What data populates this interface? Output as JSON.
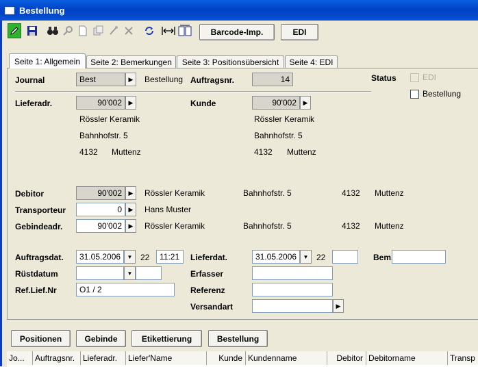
{
  "window": {
    "title": "Bestellung"
  },
  "toolbar": {
    "icons": [
      "pencil-icon",
      "save-icon",
      "binoculars-icon",
      "key-icon",
      "new-doc-icon",
      "copy-icon",
      "stamp-icon",
      "delete-icon",
      "refresh-icon",
      "width-icon",
      "pages-icon"
    ],
    "barcode_label": "Barcode-Imp.",
    "edi_label": "EDI"
  },
  "tabs": [
    "Seite 1: Allgemein",
    "Seite 2: Bemerkungen",
    "Seite 3: Positionsübersicht",
    "Seite 4: EDI"
  ],
  "form": {
    "journal_label": "Journal",
    "journal_value": "Best",
    "journal_desc": "Bestellung",
    "auftragsnr_label": "Auftragsnr.",
    "auftragsnr_value": "14",
    "status_label": "Status",
    "status_edi": "EDI",
    "status_bestellung": "Bestellung",
    "lieferadr_label": "Lieferadr.",
    "lieferadr_value": "90'002",
    "lieferadr_name": "Rössler Keramik",
    "lieferadr_street": "Bahnhofstr. 5",
    "lieferadr_plz": "4132",
    "lieferadr_city": "Muttenz",
    "kunde_label": "Kunde",
    "kunde_value": "90'002",
    "kunde_name": "Rössler Keramik",
    "kunde_street": "Bahnhofstr. 5",
    "kunde_plz": "4132",
    "kunde_city": "Muttenz",
    "debitor_label": "Debitor",
    "debitor_value": "90'002",
    "debitor_name": "Rössler Keramik",
    "debitor_street": "Bahnhofstr. 5",
    "debitor_plz": "4132",
    "debitor_city": "Muttenz",
    "transporteur_label": "Transporteur",
    "transporteur_value": "0",
    "transporteur_name": "Hans Muster",
    "gebinde_label": "Gebindeadr.",
    "gebinde_value": "90'002",
    "gebinde_name": "Rössler Keramik",
    "gebinde_street": "Bahnhofstr. 5",
    "gebinde_plz": "4132",
    "gebinde_city": "Muttenz",
    "auftragsdat_label": "Auftragsdat.",
    "auftragsdat_value": "31.05.2006",
    "auftragsdat_week": "22",
    "auftragsdat_time": "11:21",
    "lieferdat_label": "Lieferdat.",
    "lieferdat_value": "31.05.2006",
    "lieferdat_week": "22",
    "lieferdat_extra": "",
    "bem_label": "Bem.",
    "bem_value": "",
    "ruestdatum_label": "Rüstdatum",
    "ruestdatum_value": "",
    "ruestdatum_extra": "",
    "erfasser_label": "Erfasser",
    "erfasser_value": "",
    "refliefnr_label": "Ref.Lief.Nr",
    "refliefnr_value": "O1 / 2",
    "referenz_label": "Referenz",
    "referenz_value": "",
    "versandart_label": "Versandart",
    "versandart_value": ""
  },
  "bottom_buttons": [
    "Positionen",
    "Gebinde",
    "Etikettierung",
    "Bestellung"
  ],
  "table": {
    "columns": [
      "Jo...",
      "Auftragsnr.",
      "Lieferadr.",
      "Liefer'Name",
      "Kunde",
      "Kundenname",
      "Debitor",
      "Debitorname",
      "Transp"
    ]
  }
}
